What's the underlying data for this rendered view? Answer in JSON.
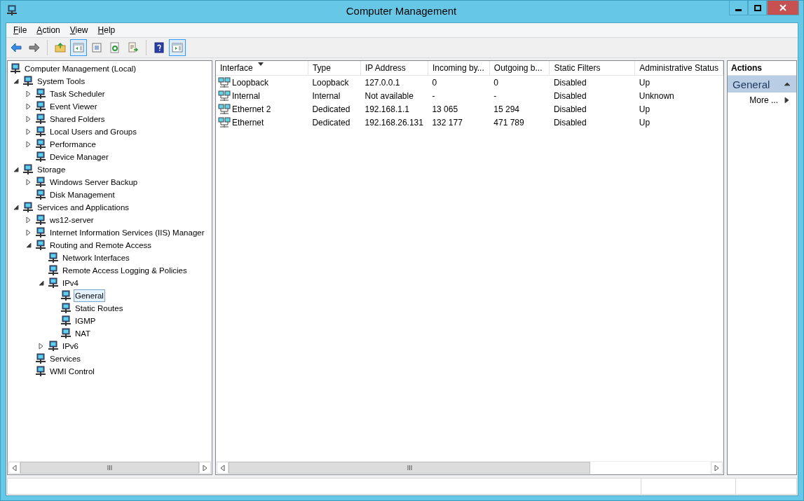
{
  "window": {
    "title": "Computer Management"
  },
  "menu": [
    {
      "label": "File"
    },
    {
      "label": "Action"
    },
    {
      "label": "View"
    },
    {
      "label": "Help"
    }
  ],
  "toolbar": [
    {
      "kind": "back",
      "pressed": false
    },
    {
      "kind": "forward",
      "pressed": false
    },
    {
      "kind": "separator"
    },
    {
      "kind": "up",
      "pressed": false
    },
    {
      "kind": "tree",
      "pressed": true
    },
    {
      "kind": "properties",
      "pressed": false
    },
    {
      "kind": "refresh",
      "pressed": false
    },
    {
      "kind": "export",
      "pressed": false
    },
    {
      "kind": "separator"
    },
    {
      "kind": "help",
      "pressed": false
    },
    {
      "kind": "actionpane",
      "pressed": true
    }
  ],
  "tree": [
    {
      "label": "Computer Management (Local)",
      "selected": false,
      "children": [
        {
          "label": "System Tools",
          "expanded": true,
          "selected": false,
          "children": [
            {
              "label": "Task Scheduler",
              "expanded": false,
              "selected": false
            },
            {
              "label": "Event Viewer",
              "expanded": false,
              "selected": false
            },
            {
              "label": "Shared Folders",
              "expanded": false,
              "selected": false
            },
            {
              "label": "Local Users and Groups",
              "expanded": false,
              "selected": false
            },
            {
              "label": "Performance",
              "expanded": false,
              "selected": false
            },
            {
              "label": "Device Manager",
              "selected": false
            }
          ]
        },
        {
          "label": "Storage",
          "expanded": true,
          "selected": false,
          "children": [
            {
              "label": "Windows Server Backup",
              "expanded": false,
              "selected": false
            },
            {
              "label": "Disk Management",
              "selected": false
            }
          ]
        },
        {
          "label": "Services and Applications",
          "expanded": true,
          "selected": false,
          "children": [
            {
              "label": "ws12-server",
              "expanded": false,
              "selected": false
            },
            {
              "label": "Internet Information Services (IIS) Manager",
              "expanded": false,
              "selected": false
            },
            {
              "label": "Routing and Remote Access",
              "expanded": true,
              "selected": false,
              "children": [
                {
                  "label": "Network Interfaces",
                  "selected": false
                },
                {
                  "label": "Remote Access Logging & Policies",
                  "selected": false
                },
                {
                  "label": "IPv4",
                  "expanded": true,
                  "selected": false,
                  "children": [
                    {
                      "label": "General",
                      "selected": true
                    },
                    {
                      "label": "Static Routes",
                      "selected": false
                    },
                    {
                      "label": "IGMP",
                      "selected": false
                    },
                    {
                      "label": "NAT",
                      "selected": false
                    }
                  ]
                },
                {
                  "label": "IPv6",
                  "expanded": false,
                  "selected": false
                }
              ]
            },
            {
              "label": "Services",
              "selected": false
            },
            {
              "label": "WMI Control",
              "selected": false
            }
          ]
        }
      ]
    }
  ],
  "table": {
    "columns": [
      {
        "label": "Interface",
        "sorted": true
      },
      {
        "label": "Type",
        "sorted": false
      },
      {
        "label": "IP Address",
        "sorted": false
      },
      {
        "label": "Incoming by...",
        "sorted": false
      },
      {
        "label": "Outgoing b...",
        "sorted": false
      },
      {
        "label": "Static Filters",
        "sorted": false
      },
      {
        "label": "Administrative Status",
        "sorted": false
      }
    ],
    "rows": [
      {
        "cells": [
          "Loopback",
          "Loopback",
          "127.0.0.1",
          "0",
          "0",
          "Disabled",
          "Up"
        ]
      },
      {
        "cells": [
          "Internal",
          "Internal",
          "Not available",
          "-",
          "-",
          "Disabled",
          "Unknown"
        ]
      },
      {
        "cells": [
          "Ethernet 2",
          "Dedicated",
          "192.168.1.1",
          "13 065",
          "15 294",
          "Disabled",
          "Up"
        ]
      },
      {
        "cells": [
          "Ethernet",
          "Dedicated",
          "192.168.26.131",
          "132 177",
          "471 789",
          "Disabled",
          "Up"
        ]
      }
    ]
  },
  "actions": {
    "title": "Actions",
    "sections": [
      {
        "label": "General",
        "expanded": true,
        "items": [
          {
            "label": "More ..."
          }
        ]
      }
    ]
  }
}
